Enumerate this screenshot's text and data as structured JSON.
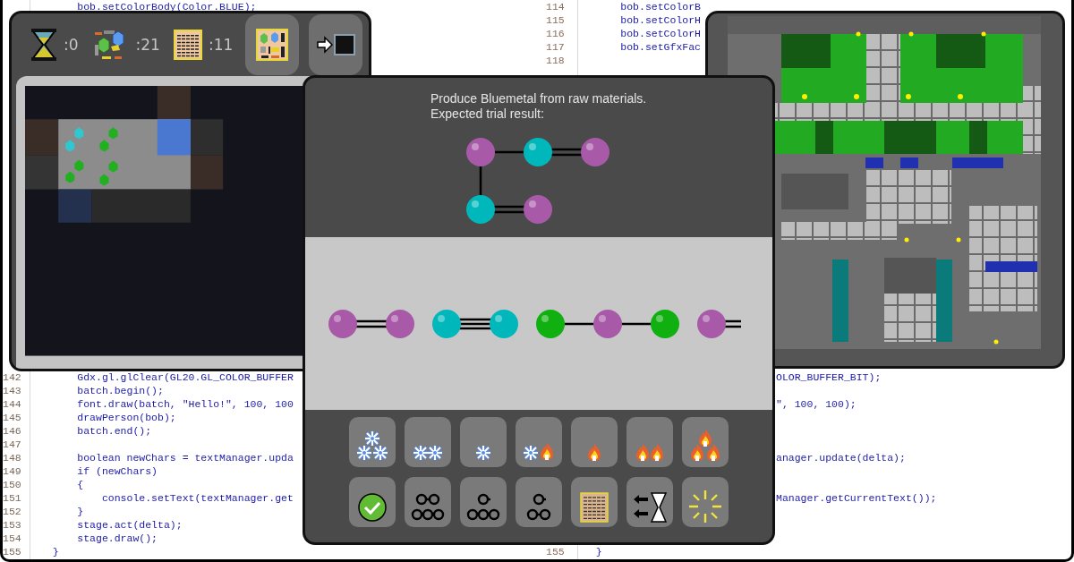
{
  "code_editor": {
    "top_rows": [
      {
        "code": "       bob.setColorBody(Color.BLUE);",
        "right_number": "114",
        "right_code": "       bob.setColorB"
      },
      {
        "right_number": "115",
        "right_code": "       bob.setColorH"
      },
      {
        "right_number": "116",
        "right_code": "       bob.setColorH"
      },
      {
        "right_number": "117",
        "right_code": "       bob.setGfxFac"
      },
      {
        "right_number": "118"
      }
    ],
    "bottom_rows": [
      {
        "number": "142",
        "code": "       Gdx.gl.glClear(GL20.GL_COLOR_BUFFER",
        "right_tail": "OLOR_BUFFER_BIT);"
      },
      {
        "number": "143",
        "code": "       batch.begin();"
      },
      {
        "number": "144",
        "code": "       font.draw(batch, \"Hello!\", 100, 100",
        "right_tail": "\", 100, 100);"
      },
      {
        "number": "145",
        "code": "       drawPerson(bob);"
      },
      {
        "number": "146",
        "code": "       batch.end();"
      },
      {
        "number": "147"
      },
      {
        "number": "148",
        "code": "       boolean newChars = textManager.upda",
        "right_tail": "anager.update(delta);"
      },
      {
        "number": "149",
        "code": "       if (newChars)"
      },
      {
        "number": "150",
        "code": "       {"
      },
      {
        "number": "151",
        "code": "           console.setText(textManager.get",
        "right_tail": "Manager.getCurrentText());"
      },
      {
        "number": "152",
        "code": "       }"
      },
      {
        "number": "153",
        "code": "       stage.act(delta);"
      },
      {
        "number": "154",
        "code": "       stage.draw();"
      },
      {
        "number": "155",
        "code": "   }",
        "right_number": "155",
        "right_code": "   }"
      }
    ]
  },
  "game_window": {
    "counters": [
      {
        "kind": "time",
        "value": ":0"
      },
      {
        "kind": "materials",
        "value": ":21"
      },
      {
        "kind": "scrolls",
        "value": ":11"
      }
    ],
    "buttons": [
      {
        "kind": "blueprint"
      },
      {
        "kind": "exit"
      }
    ]
  },
  "trial_window": {
    "instruction_lines": [
      "Produce Bluemetal from raw materials.",
      "Expected trial result:"
    ],
    "tools": [
      {
        "kind": "freeze3"
      },
      {
        "kind": "freeze2"
      },
      {
        "kind": "freeze1"
      },
      {
        "kind": "mixed"
      },
      {
        "kind": "heat1"
      },
      {
        "kind": "heat2"
      },
      {
        "kind": "heat3"
      },
      {
        "kind": "accept"
      },
      {
        "kind": "split23"
      },
      {
        "kind": "split13"
      },
      {
        "kind": "split12"
      },
      {
        "kind": "scroll"
      },
      {
        "kind": "rewind"
      },
      {
        "kind": "explode"
      }
    ]
  }
}
